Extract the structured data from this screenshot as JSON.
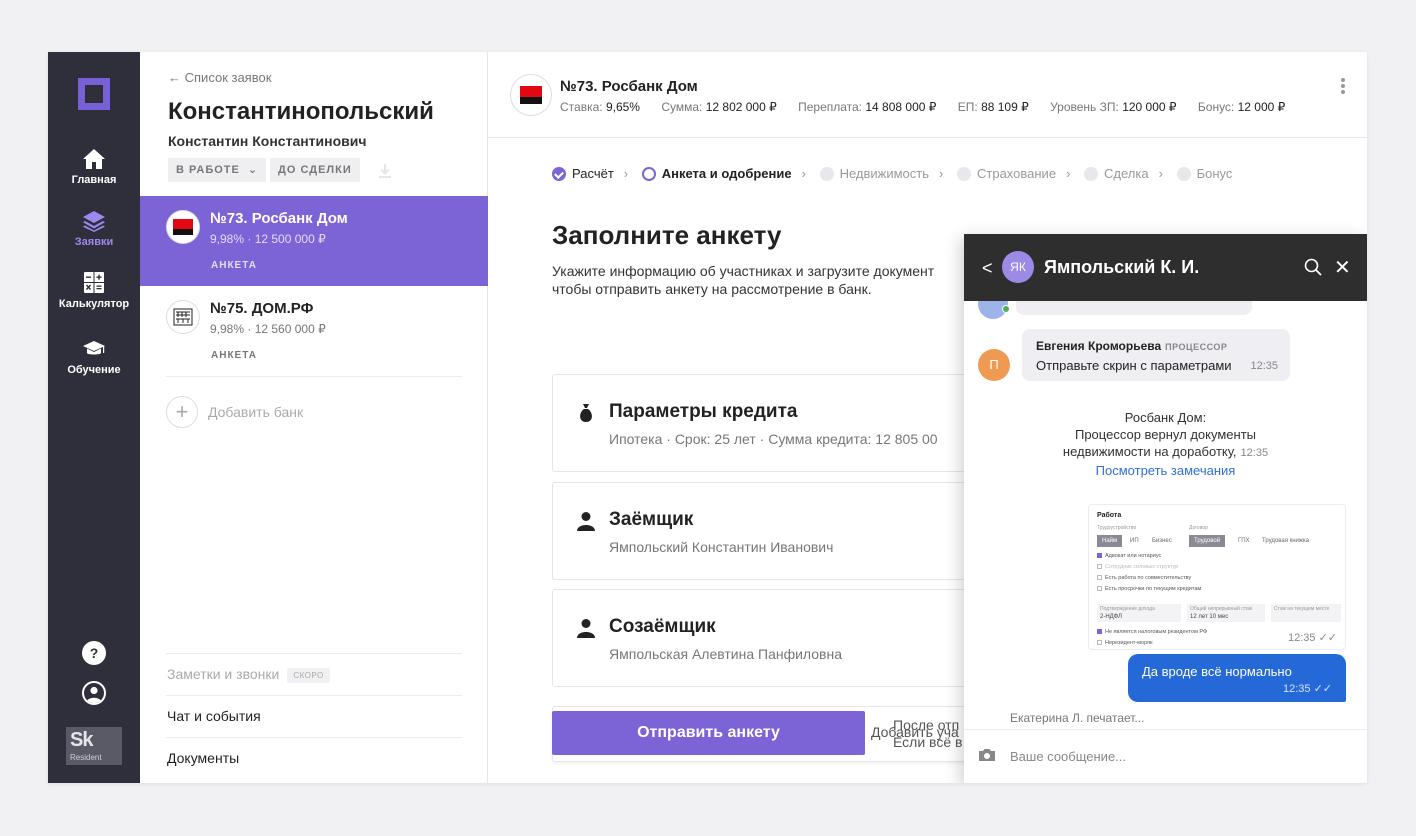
{
  "sidebar": {
    "items": [
      {
        "label": "Главная",
        "icon": "home-icon"
      },
      {
        "label": "Заявки",
        "icon": "layers-icon",
        "active": true
      },
      {
        "label": "Калькулятор",
        "icon": "calculator-icon"
      },
      {
        "label": "Обучение",
        "icon": "graduation-cap-icon"
      }
    ],
    "help_label": "?",
    "badge": {
      "logo": "Sk",
      "caption": "Resident"
    },
    "accent_color": "#7a60d6"
  },
  "requests": {
    "back_label": "Список заявок",
    "client_last_name": "Константинопольский",
    "client_first_name": "Константин Константинович",
    "status_tag": "В РАБОТЕ",
    "deal_tag": "ДО СДЕЛКИ",
    "banks": [
      {
        "name": "№73. Росбанк Дом",
        "details": "9,98% · 12 500 000 ₽",
        "status": "АНКЕТА",
        "active": true
      },
      {
        "name": "№75. ДОМ.РФ",
        "details": "9,98% · 12 560 000 ₽",
        "status": "АНКЕТА",
        "active": false
      }
    ],
    "add_bank_label": "Добавить банк",
    "bottom": {
      "notes_label": "Заметки и звонки",
      "notes_badge": "СКОРО",
      "chat_label": "Чат и события",
      "docs_label": "Документы"
    }
  },
  "header": {
    "title": "№73. Росбанк Дом",
    "stats": [
      {
        "label": "Ставка:",
        "value": "9,65%"
      },
      {
        "label": "Сумма:",
        "value": "12 802 000 ₽"
      },
      {
        "label": "Переплата:",
        "value": "14 808 000 ₽"
      },
      {
        "label": "ЕП:",
        "value": "88 109 ₽"
      },
      {
        "label": "Уровень ЗП:",
        "value": "120 000 ₽"
      },
      {
        "label": "Бонус:",
        "value": "12 000 ₽"
      }
    ]
  },
  "main": {
    "steps": [
      {
        "label": "Расчёт",
        "state": "done"
      },
      {
        "label": "Анкета и одобрение",
        "state": "current"
      },
      {
        "label": "Недвижимость",
        "state": "todo"
      },
      {
        "label": "Страхование",
        "state": "todo"
      },
      {
        "label": "Сделка",
        "state": "todo"
      },
      {
        "label": "Бонус",
        "state": "todo"
      }
    ],
    "title": "Заполните анкету",
    "description": "Укажите информацию об участниках и загрузите документ чтобы отправить анкету на рассмотрение в банк.",
    "cards": [
      {
        "title": "Параметры кредита",
        "subtitle": "Ипотека · Срок: 25 лет · Сумма кредита: 12 805 00",
        "icon": "money-bag-icon"
      },
      {
        "title": "Заёмщик",
        "subtitle": "Ямпольский Константин Иванович",
        "icon": "person-icon"
      },
      {
        "title": "Созаёмщик",
        "subtitle": "Ямпольская Алевтина Панфиловна",
        "icon": "person-icon"
      }
    ],
    "add_participant_label": "Добавить уча",
    "submit_label": "Отправить анкету",
    "after_line1": "После отп",
    "after_line2": "Если всё в"
  },
  "chat": {
    "initials": "ЯК",
    "name": "Ямпольский К. И.",
    "messages": {
      "incoming": {
        "avatar": "П",
        "sender": "Евгения Кроморьева",
        "role": "ПРОЦЕССОР",
        "text": "Отправьте скрин с параметрами",
        "time": "12:35"
      },
      "system": {
        "line1": "Росбанк Дом:",
        "line2": "Процессор вернул документы",
        "line3": "недвижимости на доработку,",
        "time": "12:35",
        "link": "Посмотреть замечания"
      },
      "screenshot": {
        "title": "Работа",
        "employment_label": "Трудоустройство",
        "employment_options": [
          "Найм",
          "ИП",
          "Бизнес"
        ],
        "contract_label": "Договор",
        "contract_options": [
          "Трудовой",
          "ГПХ",
          "Трудовая книжка"
        ],
        "checks": [
          "Адвокат или нотариус",
          "Сотрудник силовых структур",
          "Есть работа по совместительству",
          "Есть просрочки по текущим кредитам"
        ],
        "income_label": "Подтверждение дохода",
        "income_value": "2-НДФЛ",
        "experience_label": "Общий непрерывный стаж",
        "experience_value": "12 лет 10 мес",
        "current_label": "Стаж на текущем месте",
        "tax_check": "Не является налоговым резидентом РФ",
        "nonresident": "Нерезидент-моряк",
        "time": "12:35"
      },
      "outgoing": {
        "text": "Да вроде всё нормально",
        "time": "12:35"
      }
    },
    "typing": "Екатерина Л. печатает...",
    "input_placeholder": "Ваше сообщение..."
  }
}
